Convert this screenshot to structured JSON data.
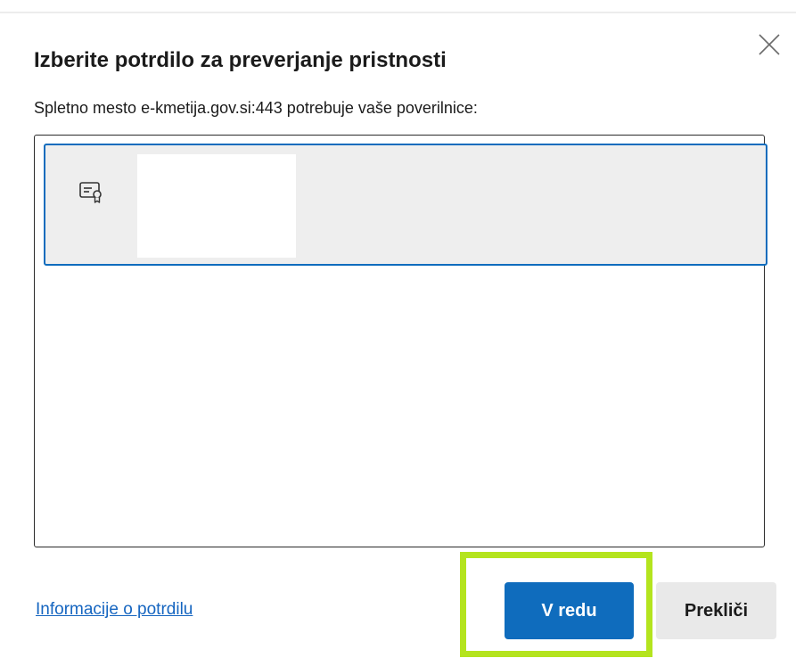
{
  "dialog": {
    "title": "Izberite potrdilo za preverjanje pristnosti",
    "subtitle": "Spletno mesto e-kmetija.gov.si:443 potrebuje vaše poverilnice:",
    "close_icon": "close-icon"
  },
  "certificate_list": {
    "items": [
      {
        "icon": "certificate-icon",
        "name": "",
        "selected": true
      }
    ]
  },
  "footer": {
    "info_link_label": "Informacije o potrdilu",
    "ok_label": "V redu",
    "cancel_label": "Prekliči"
  },
  "colors": {
    "accent": "#0f6cbd",
    "highlight": "#b4e41e",
    "link": "#1565c0",
    "selected_item_bg": "#eeeeee",
    "cancel_bg": "#e9e9e9"
  }
}
